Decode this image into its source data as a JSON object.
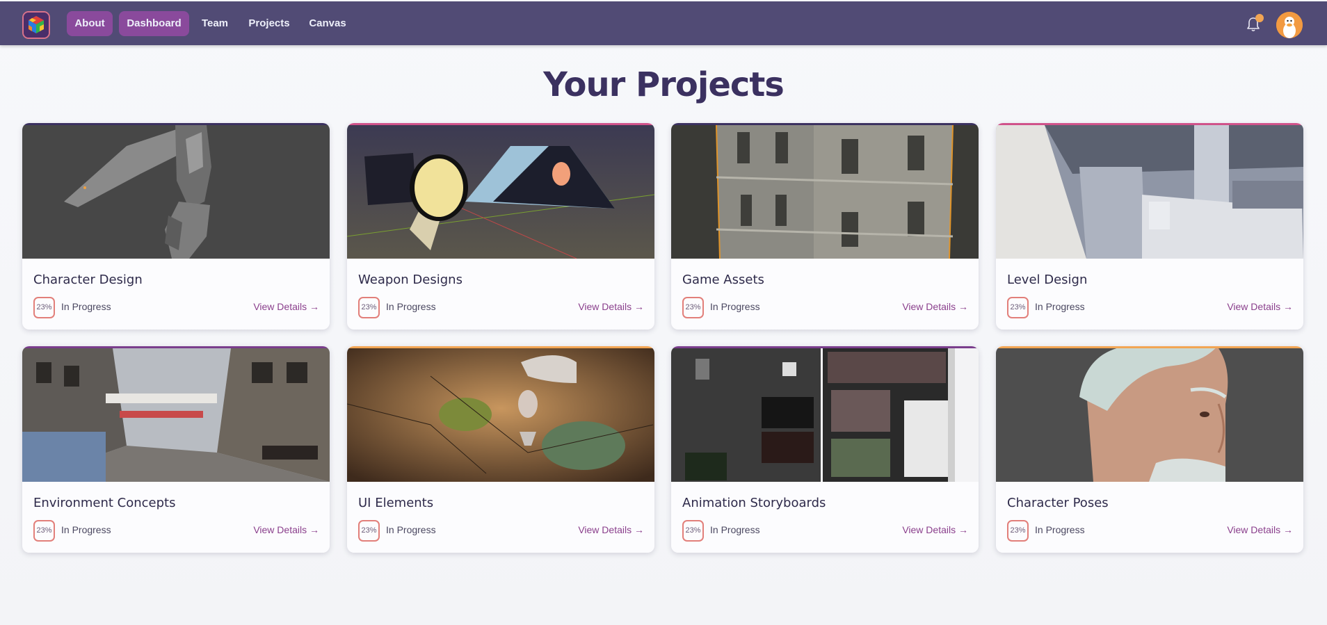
{
  "colors": {
    "navbar": "#514b75",
    "nav_active": "#8a4a9c",
    "title": "#3b3160",
    "link": "#8a3f8c",
    "notification_dot": "#f2a553"
  },
  "nav": {
    "items": [
      {
        "label": "About",
        "active": true
      },
      {
        "label": "Dashboard",
        "active": true
      },
      {
        "label": "Team",
        "active": false
      },
      {
        "label": "Projects",
        "active": false
      },
      {
        "label": "Canvas",
        "active": false
      }
    ],
    "icons": {
      "logo": "rubiks-cube-logo",
      "notifications": "bell-icon",
      "avatar": "duck-avatar"
    }
  },
  "page": {
    "title": "Your Projects"
  },
  "projects": [
    {
      "title": "Character Design",
      "progress": "23%",
      "status": "In Progress",
      "link": "View Details →",
      "accent": "#3b3160",
      "image": "robot-character-render"
    },
    {
      "title": "Weapon Designs",
      "progress": "23%",
      "status": "In Progress",
      "link": "View Details →",
      "accent": "#d0528a",
      "image": "spotlight-weapon-render"
    },
    {
      "title": "Game Assets",
      "progress": "23%",
      "status": "In Progress",
      "link": "View Details →",
      "accent": "#3b3160",
      "image": "building-asset-render"
    },
    {
      "title": "Level Design",
      "progress": "23%",
      "status": "In Progress",
      "link": "View Details →",
      "accent": "#d0528a",
      "image": "grey-level-blockout"
    },
    {
      "title": "Environment Concepts",
      "progress": "23%",
      "status": "In Progress",
      "link": "View Details →",
      "accent": "#7a3d8c",
      "image": "city-street-concept"
    },
    {
      "title": "UI Elements",
      "progress": "23%",
      "status": "In Progress",
      "link": "View Details →",
      "accent": "#f2a553",
      "image": "tabletop-map-scene"
    },
    {
      "title": "Animation Storyboards",
      "progress": "23%",
      "status": "In Progress",
      "link": "View Details →",
      "accent": "#7a3d8c",
      "image": "storyboard-sheets"
    },
    {
      "title": "Character Poses",
      "progress": "23%",
      "status": "In Progress",
      "link": "View Details →",
      "accent": "#f2a553",
      "image": "old-man-portrait"
    }
  ]
}
